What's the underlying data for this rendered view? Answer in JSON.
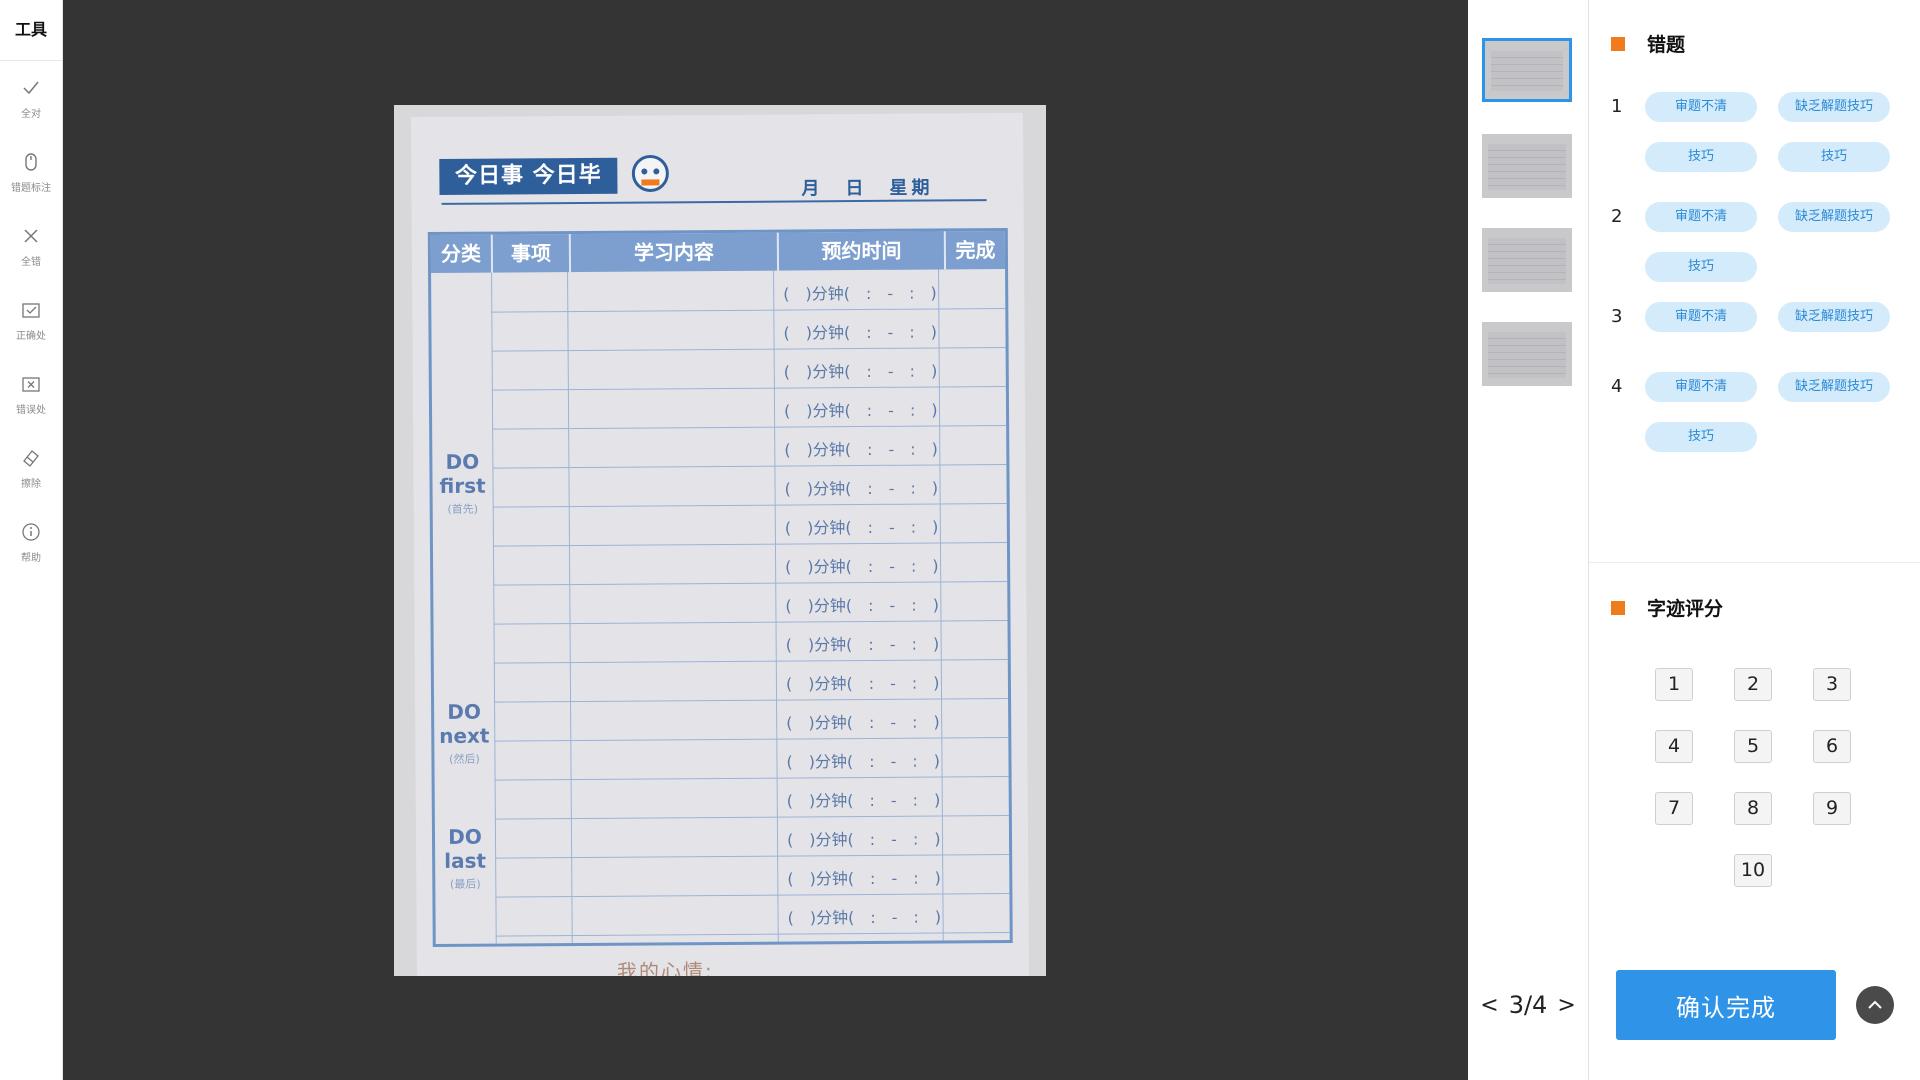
{
  "toolbar": {
    "title": "工具",
    "tools": [
      {
        "label": "全对",
        "icon": "check-icon"
      },
      {
        "label": "错题标注",
        "icon": "mouse-icon"
      },
      {
        "label": "全错",
        "icon": "x-icon"
      },
      {
        "label": "正确处",
        "icon": "check-box-icon"
      },
      {
        "label": "错误处",
        "icon": "x-box-icon"
      },
      {
        "label": "擦除",
        "icon": "eraser-icon"
      },
      {
        "label": "帮助",
        "icon": "info-icon"
      }
    ]
  },
  "photo": {
    "header": "今日事 今日毕",
    "date_line": "月　日　星期",
    "columns": [
      "分类",
      "事项",
      "学习内容",
      "预约时间",
      "完成"
    ],
    "slot_text": "(　)分钟(　:　-　:　)",
    "slot_count": 17,
    "categories": [
      {
        "title": "DO\nfirst",
        "sub": "(首先)"
      },
      {
        "title": "DO\nnext",
        "sub": "(然后)"
      },
      {
        "title": "DO\nlast",
        "sub": "(最后)"
      }
    ],
    "mood": "我的心情:"
  },
  "thumbnails": {
    "count": 4,
    "active": 1
  },
  "pager": {
    "prev": "<",
    "current": "3/4",
    "next": ">"
  },
  "errors": {
    "title": "错题",
    "items": [
      {
        "num": "1",
        "tags": [
          "审题不清",
          "缺乏解题技巧",
          "技巧",
          "技巧"
        ]
      },
      {
        "num": "2",
        "tags": [
          "审题不清",
          "缺乏解题技巧",
          "技巧"
        ]
      },
      {
        "num": "3",
        "tags": [
          "审题不清",
          "缺乏解题技巧"
        ]
      },
      {
        "num": "4",
        "tags": [
          "审题不清",
          "缺乏解题技巧",
          "技巧"
        ]
      }
    ]
  },
  "handwriting": {
    "title": "字迹评分",
    "scores": [
      "1",
      "2",
      "3",
      "4",
      "5",
      "6",
      "7",
      "8",
      "9",
      "10"
    ]
  },
  "confirm_label": "确认完成",
  "colors": {
    "accent": "#2f94e8",
    "orange": "#f07b1d",
    "viewer_bg": "#343434",
    "tag_bg": "#d3ebfb"
  }
}
